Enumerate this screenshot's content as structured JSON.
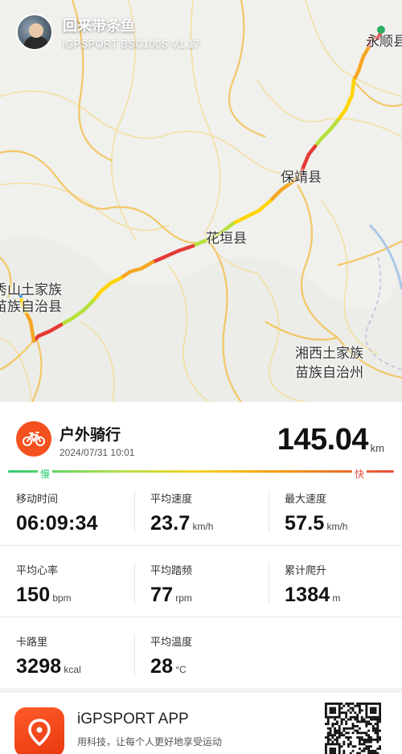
{
  "map": {
    "labels": {
      "yongshun": "永顺县",
      "baojing": "保靖县",
      "huayuan": "花垣县",
      "xiushan_1": "秀山土家族",
      "xiushan_2": "苗族自治县",
      "xiangxi_1": "湘西土家族",
      "xiangxi_2": "苗族自治州"
    },
    "route_colors": [
      "#e53935",
      "#f5a623",
      "#ffd400",
      "#b6e03a"
    ]
  },
  "user": {
    "name": "回来带条鱼",
    "device": "iGPSPORT BSC100S V1.17"
  },
  "activity": {
    "title": "户外骑行",
    "datetime": "2024/07/31 10:01",
    "distance": "145.04",
    "distance_unit": "km",
    "icon": "bicycle-icon",
    "slow_label": "慢",
    "fast_label": "快"
  },
  "stats": {
    "moving_time": {
      "label": "移动时间",
      "value": "06:09:34",
      "unit": ""
    },
    "avg_speed": {
      "label": "平均速度",
      "value": "23.7",
      "unit": "km/h"
    },
    "max_speed": {
      "label": "最大速度",
      "value": "57.5",
      "unit": "km/h"
    },
    "avg_hr": {
      "label": "平均心率",
      "value": "150",
      "unit": "bpm"
    },
    "avg_cadence": {
      "label": "平均踏频",
      "value": "77",
      "unit": "rpm"
    },
    "elevation_gain": {
      "label": "累计爬升",
      "value": "1384",
      "unit": "m"
    },
    "calories": {
      "label": "卡路里",
      "value": "3298",
      "unit": "kcal"
    },
    "avg_temp": {
      "label": "平均温度",
      "value": "28",
      "unit": "°C"
    }
  },
  "footer": {
    "app_name": "iGPSPORT APP",
    "slogan": "用科技，让每个人更好地享受运动",
    "app_icon": "location-pin-icon",
    "qr": "qr-code"
  },
  "colors": {
    "accent": "#f4511e",
    "slow": "#2ecc71",
    "fast": "#e74c3c"
  }
}
